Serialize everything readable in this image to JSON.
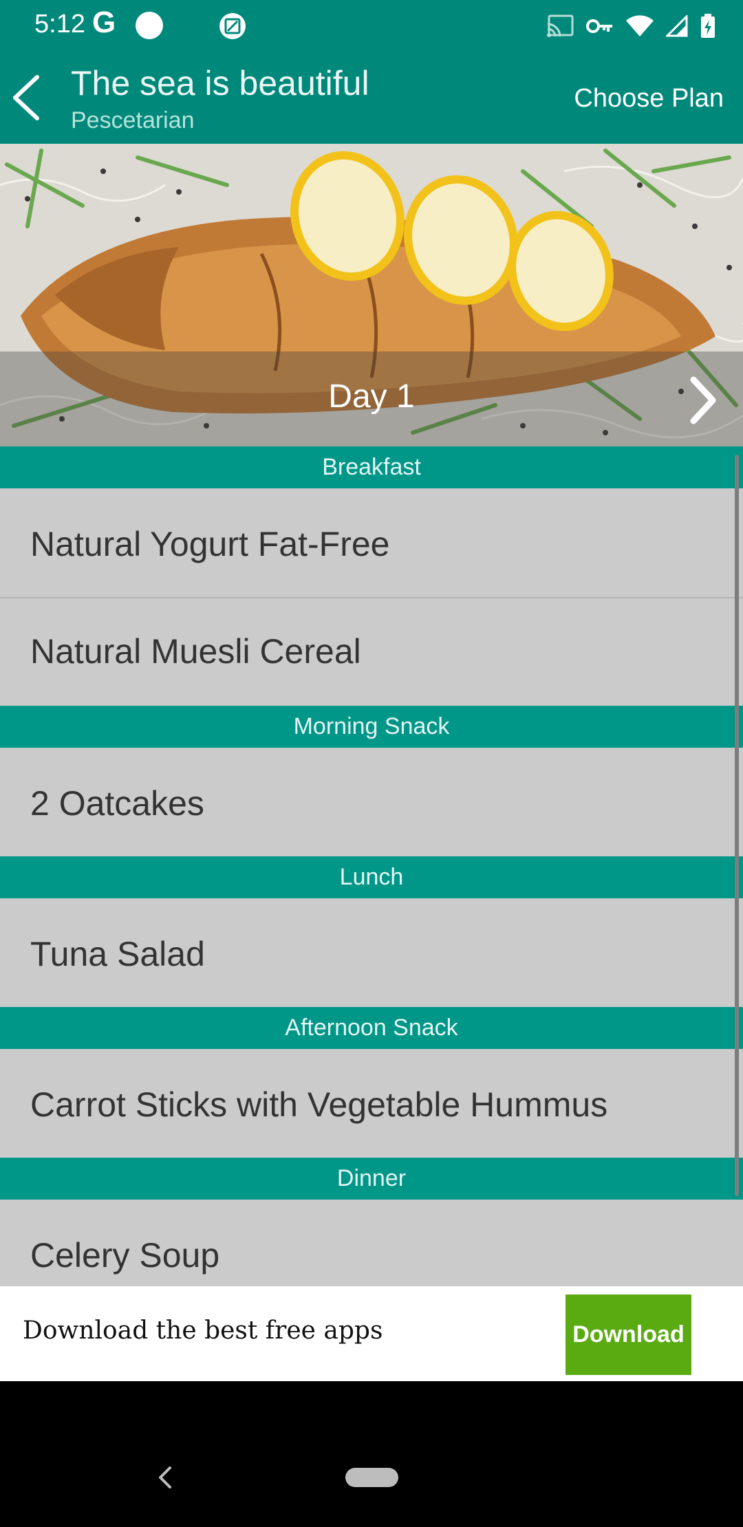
{
  "status_bar": {
    "time": "5:12",
    "g_glyph": "G",
    "icons": [
      "google-icon",
      "circle-notification-icon",
      "screenshot-icon",
      "cast-icon",
      "vpn-key-icon",
      "wifi-icon",
      "signal-icon",
      "battery-charging-icon"
    ]
  },
  "app_bar": {
    "title": "The sea is beautiful",
    "subtitle": "Pescetarian",
    "choose_plan": "Choose Plan"
  },
  "hero": {
    "day_label": "Day 1"
  },
  "sections": [
    {
      "header": "Breakfast",
      "items": [
        "Natural Yogurt Fat-Free",
        "Natural Muesli Cereal"
      ]
    },
    {
      "header": "Morning Snack",
      "items": [
        "2 Oatcakes"
      ]
    },
    {
      "header": "Lunch",
      "items": [
        "Tuna Salad"
      ]
    },
    {
      "header": "Afternoon Snack",
      "items": [
        "Carrot Sticks with Vegetable Hummus"
      ]
    },
    {
      "header": "Dinner",
      "items": [
        "Celery Soup"
      ]
    }
  ],
  "ad": {
    "text": "Download the best free apps",
    "button": "Download"
  },
  "colors": {
    "primary": "#00897b",
    "section_header": "#009688",
    "list_bg": "#cbcbcb",
    "ad_button": "#5aab12"
  }
}
